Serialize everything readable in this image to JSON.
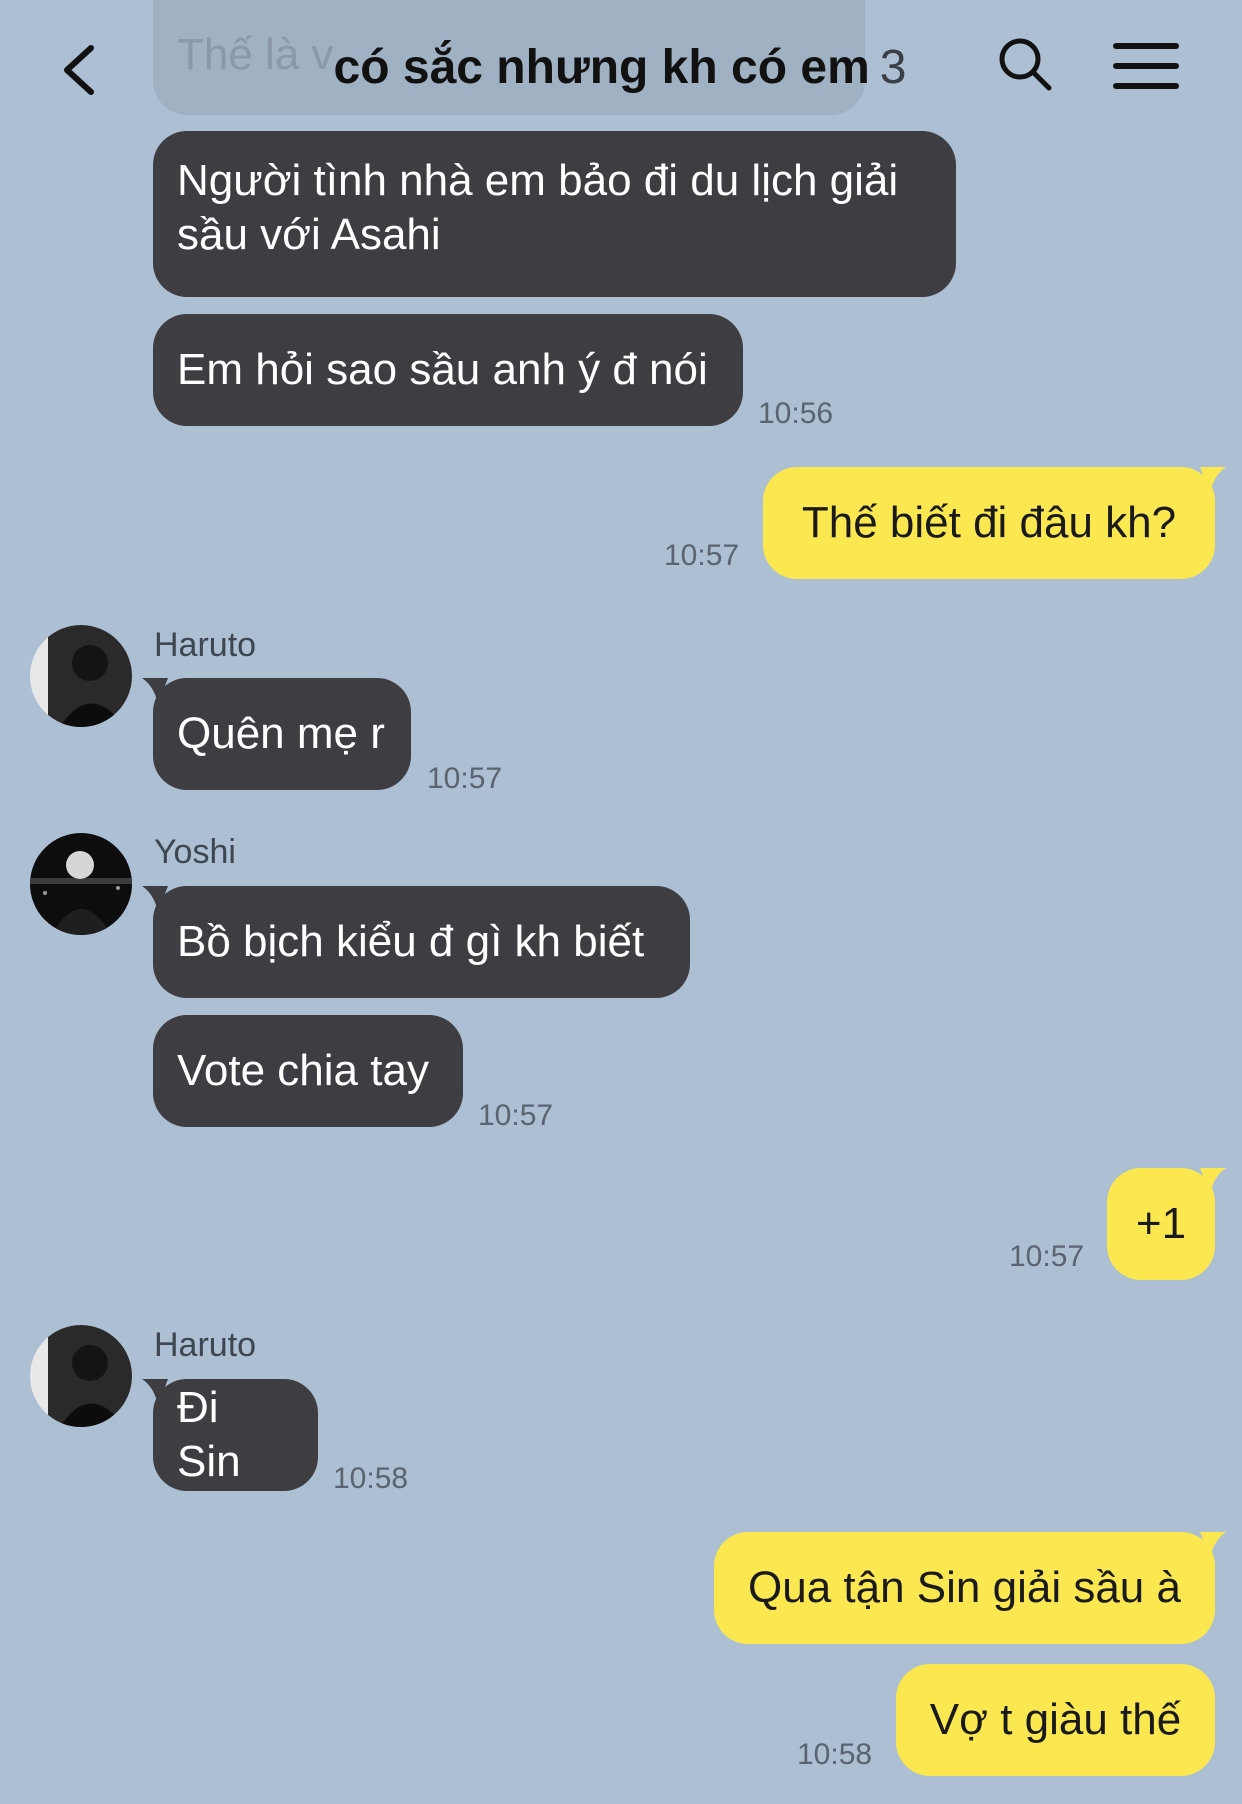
{
  "header": {
    "title": "có sắc nhưng kh có em",
    "member_count": "3"
  },
  "partial_top_message": "Thế là v",
  "messages": [
    {
      "text": "Người tình nhà em bảo đi du lịch giải sầu với Asahi"
    },
    {
      "text": "Em hỏi sao sầu anh ý đ nói",
      "time": "10:56"
    },
    {
      "text": "Thế biết đi đâu kh?",
      "time": "10:57"
    },
    {
      "sender": "Haruto",
      "text": "Quên mẹ r",
      "time": "10:57"
    },
    {
      "sender": "Yoshi",
      "text": "Bồ bịch kiểu đ gì kh biết"
    },
    {
      "text": "Vote chia tay",
      "time": "10:57"
    },
    {
      "text": "+1",
      "time": "10:57"
    },
    {
      "sender": "Haruto",
      "text": "Đi Sin",
      "time": "10:58"
    },
    {
      "text": "Qua tận Sin giải sầu à"
    },
    {
      "text": "Vợ t giàu thế",
      "time": "10:58"
    }
  ],
  "colors": {
    "background": "#acbfd3",
    "incoming_bubble": "#3e3d41",
    "outgoing_bubble": "#fbe74f",
    "timestamp": "#5a6470"
  },
  "icons": {
    "back": "chevron-left-icon",
    "search": "search-icon",
    "menu": "hamburger-menu-icon"
  }
}
